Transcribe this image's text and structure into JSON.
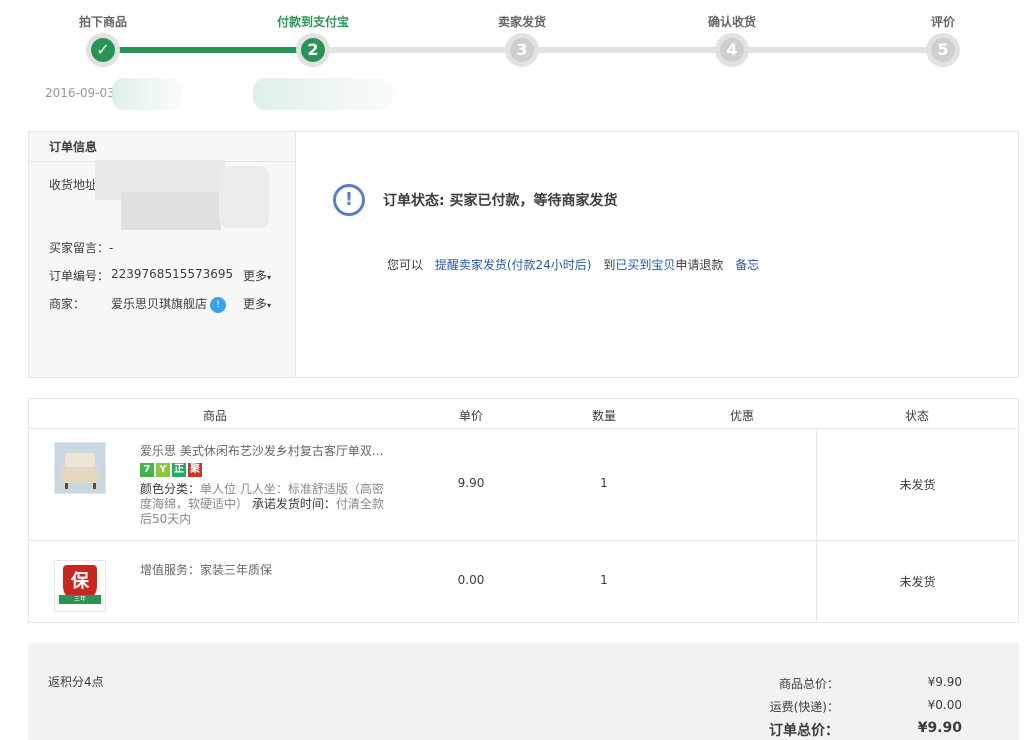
{
  "steps": [
    {
      "label": "拍下商品",
      "num": "✓",
      "state": "done"
    },
    {
      "label": "付款到支付宝",
      "num": "2",
      "state": "current"
    },
    {
      "label": "卖家发货",
      "num": "3",
      "state": "pending"
    },
    {
      "label": "确认收货",
      "num": "4",
      "state": "pending"
    },
    {
      "label": "评价",
      "num": "5",
      "state": "pending"
    }
  ],
  "step_date": "2016-09-03",
  "order_info": {
    "title": "订单信息",
    "address_label": "收货地址",
    "message_label": "买家留言：",
    "message_value": "-",
    "order_no_label": "订单编号：",
    "order_no_value": "2239768515573695",
    "seller_label": "商家：",
    "seller_value": "爱乐思贝琪旗舰店",
    "more_label": "更多",
    "more_label_2": "更多"
  },
  "status": {
    "icon": "exclamation-icon",
    "text": "订单状态: 买家已付款，等待商家发货",
    "prefix": "您可以",
    "action_remind": "提醒卖家发货(付款24小时后)",
    "action_mid": "到",
    "action_refund_link": "已买到宝贝",
    "action_refund_tail": "申请退款",
    "action_memo": "备忘"
  },
  "goods_table": {
    "headers": [
      "商品",
      "单价",
      "数量",
      "优惠",
      "状态"
    ],
    "rows": [
      {
        "name": "爱乐思 美式休闲布艺沙发乡村复古客厅单双...",
        "badges": [
          {
            "text": "7",
            "color": "#45b549"
          },
          {
            "text": "Y",
            "color": "#8cc63f"
          },
          {
            "text": "正",
            "color": "#2aa868"
          },
          {
            "text": "聚",
            "color": "#c0392b"
          }
        ],
        "sku_label": "颜色分类：",
        "sku_value": "单人位 几人坐：标准舒适版（高密度海绵，软硬适中）",
        "promise_label": "承诺发货时间：",
        "promise_value": "付清全款后50天内",
        "price": "9.90",
        "qty": "1",
        "discount": "",
        "status": "未发货"
      },
      {
        "name": "增值服务：家装三年质保",
        "price": "0.00",
        "qty": "1",
        "discount": "",
        "status": "未发货",
        "shield_char": "保",
        "shield_ribbon": "三年"
      }
    ]
  },
  "footer": {
    "points": "返积分4点",
    "goods_total_label": "商品总价：",
    "goods_total_value": "¥9.90",
    "shipping_label": "运费(快递)：",
    "shipping_value": "¥0.00",
    "order_total_label": "订单总价：",
    "order_total_value": "¥9.90"
  },
  "colors": {
    "accent": "#2a9457",
    "link": "#2458a6",
    "status_icon": "#5b7ec9"
  }
}
